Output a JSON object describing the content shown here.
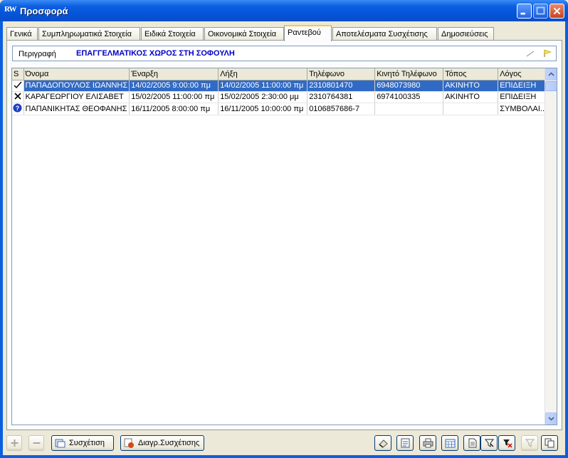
{
  "window": {
    "title": "Προσφορά",
    "app_icon_text": "RW"
  },
  "tabs": [
    {
      "label": "Γενικά"
    },
    {
      "label": "Συμπληρωματικά Στοιχεία"
    },
    {
      "label": "Ειδικά Στοιχεία"
    },
    {
      "label": "Οικονομικά Στοιχεία"
    },
    {
      "label": "Ραντεβού"
    },
    {
      "label": "Αποτελέσματα Συσχέτισης"
    },
    {
      "label": "Δημοσιεύσεις"
    }
  ],
  "active_tab": "Ραντεβού",
  "description": {
    "label": "Περιγραφή",
    "value": "ΕΠΑΓΓΕΛΜΑΤΙΚΟΣ ΧΩΡΟΣ ΣΤΗ ΣΟΦΟΥΛΗ"
  },
  "table": {
    "columns": [
      "S",
      "Όνομα",
      "Έναρξη",
      "Λήξη",
      "Τηλέφωνο",
      "Κινητό Τηλέφωνο",
      "Τόπος",
      "Λόγος"
    ],
    "rows": [
      {
        "status_icon": "check-icon",
        "name": "ΠΑΠΑΔΟΠΟΥΛΟΣ ΙΩΑΝΝΗΣ",
        "start": "14/02/2005 9:00:00 πμ",
        "end": "14/02/2005 11:00:00 πμ",
        "phone": "2310801470",
        "mobile": "6948073980",
        "place": "ΑΚΙΝΗΤΟ",
        "reason": "ΕΠΙΔΕΙΞΗ",
        "selected": true
      },
      {
        "status_icon": "cross-icon",
        "name": "ΚΑΡΑΓΕΩΡΓΙΟΥ ΕΛΙΣΑΒΕΤ",
        "start": "15/02/2005 11:00:00 πμ",
        "end": "15/02/2005 2:30:00 μμ",
        "phone": "2310764381",
        "mobile": "6974100335",
        "place": "ΑΚΙΝΗΤΟ",
        "reason": "ΕΠΙΔΕΙΞΗ",
        "selected": false
      },
      {
        "status_icon": "question-icon",
        "name": "ΠΑΠΑΝΙΚΗΤΑΣ ΘΕΟΦΑΝΗΣ",
        "start": "16/11/2005 8:00:00 πμ",
        "end": "16/11/2005 10:00:00 πμ",
        "phone": "0106857686-7",
        "mobile": "",
        "place": "",
        "reason": "ΣΥΜΒΟΛΑΙ...",
        "selected": false
      }
    ]
  },
  "bottom": {
    "relate_label": "Συσχέτιση",
    "unrelate_label": "Διαγρ.Συσχέτισης",
    "icons": [
      "plus-icon",
      "minus-icon",
      "link-icon",
      "unlink-icon",
      "erase-icon",
      "report-icon",
      "print-icon",
      "calendar-icon",
      "document-icon",
      "filter-icon",
      "filter-clear-icon",
      "filter-disabled-icon",
      "copy-icon"
    ]
  },
  "colors": {
    "selection": "#316ac5",
    "title_blue": "#0a5fe0",
    "description_text": "#0000c8"
  }
}
